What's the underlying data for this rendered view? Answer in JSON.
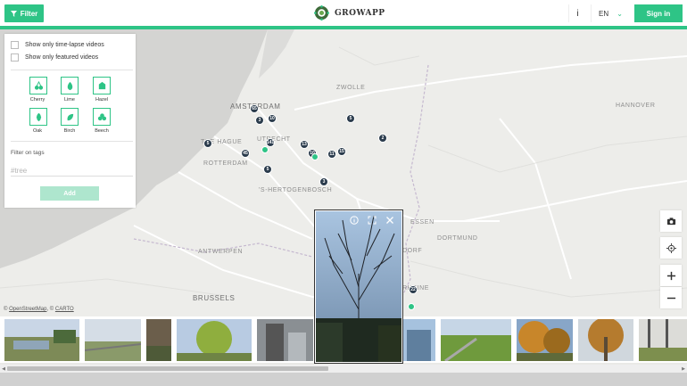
{
  "header": {
    "filter_label": "Filter",
    "app_name": "GROWAPP",
    "info_label": "i",
    "language": "EN",
    "signin_label": "Sign in",
    "accent_color": "#2ec486"
  },
  "panel": {
    "checkboxes": [
      {
        "label": "Show only time-lapse videos",
        "checked": false
      },
      {
        "label": "Show only featured videos",
        "checked": false
      }
    ],
    "trees": [
      {
        "label": "Cherry",
        "icon": "cherry-icon"
      },
      {
        "label": "Lime",
        "icon": "lime-icon"
      },
      {
        "label": "Hazel",
        "icon": "hazel-icon"
      },
      {
        "label": "Oak",
        "icon": "oak-icon"
      },
      {
        "label": "Birch",
        "icon": "birch-icon"
      },
      {
        "label": "Beech",
        "icon": "beech-icon"
      }
    ],
    "tags_label": "Filter on tags",
    "tags_placeholder": "#tree",
    "add_label": "Add"
  },
  "map": {
    "cities": [
      {
        "name": "ZWOLLE"
      },
      {
        "name": "AMSTERDAM"
      },
      {
        "name": "HANNOVER"
      },
      {
        "name": "ROTTERDAM"
      },
      {
        "name": "THE HAGUE"
      },
      {
        "name": "UTRECHT"
      },
      {
        "name": "'S-HERTOGENBOSCH"
      },
      {
        "name": "ESSEN"
      },
      {
        "name": "DORTMUND"
      },
      {
        "name": "ANTWERPEN"
      },
      {
        "name": "BRUSSELS"
      },
      {
        "name": "DORF"
      },
      {
        "name": "RHEINE"
      }
    ],
    "clusters": [
      "65",
      "3",
      "10",
      "5",
      "141",
      "13",
      "2",
      "45",
      "10",
      "11",
      "15",
      "5",
      "5",
      "3",
      "22"
    ],
    "attribution": {
      "prefix": "©",
      "osm": "OpenStreetMap",
      "sep": ", ©",
      "carto": "CARTO"
    }
  },
  "controls": [
    "camera-icon",
    "locate-icon",
    "zoom-in-icon",
    "zoom-out-icon"
  ],
  "popup": {
    "icons": [
      "info-icon",
      "fullscreen-icon",
      "close-icon"
    ]
  }
}
